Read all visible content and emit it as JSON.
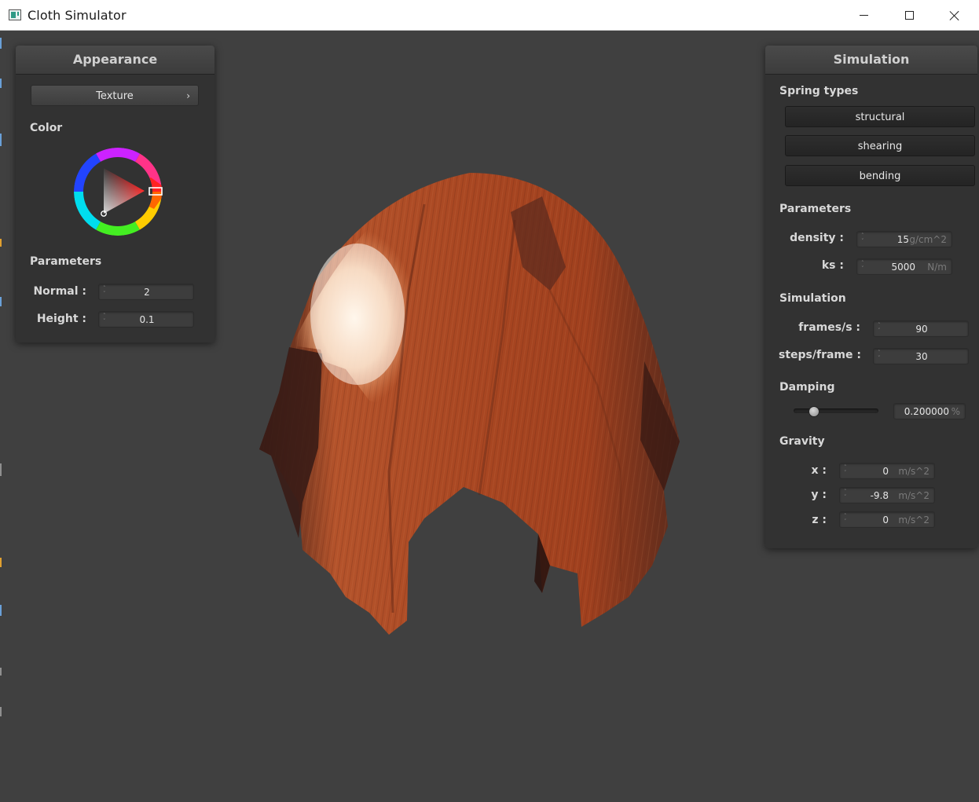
{
  "window": {
    "title": "Cloth Simulator",
    "controls": [
      "minimize-icon",
      "maximize-icon",
      "close-icon"
    ]
  },
  "appearance": {
    "header": "Appearance",
    "texture_button": "Texture",
    "texture_chevron": "›",
    "color_label": "Color",
    "color_value": "#ff0000",
    "parameters_label": "Parameters",
    "normal_label": "Normal :",
    "normal_value": "2",
    "height_label": "Height :",
    "height_value": "0.1"
  },
  "simulation": {
    "header": "Simulation",
    "spring_types_label": "Spring types",
    "spring_types": [
      "structural",
      "shearing",
      "bending"
    ],
    "parameters_label": "Parameters",
    "density_label": "density :",
    "density_value": "15",
    "density_unit": "g/cm^2",
    "ks_label": "ks :",
    "ks_value": "5000",
    "ks_unit": "N/m",
    "simulation_label": "Simulation",
    "fps_label": "frames/s :",
    "fps_value": "90",
    "steps_label": "steps/frame :",
    "steps_value": "30",
    "damping_label": "Damping",
    "damping_fraction": 0.2,
    "damping_value": "0.200000",
    "damping_unit": "%",
    "gravity_label": "Gravity",
    "gx_label": "x :",
    "gx_value": "0",
    "gy_label": "y :",
    "gy_value": "-9.8",
    "gz_label": "z :",
    "gz_value": "0",
    "gravity_unit": "m/s^2"
  },
  "colors": {
    "background": "#404040",
    "panel": "#323232",
    "cloth": "#b2522a"
  }
}
